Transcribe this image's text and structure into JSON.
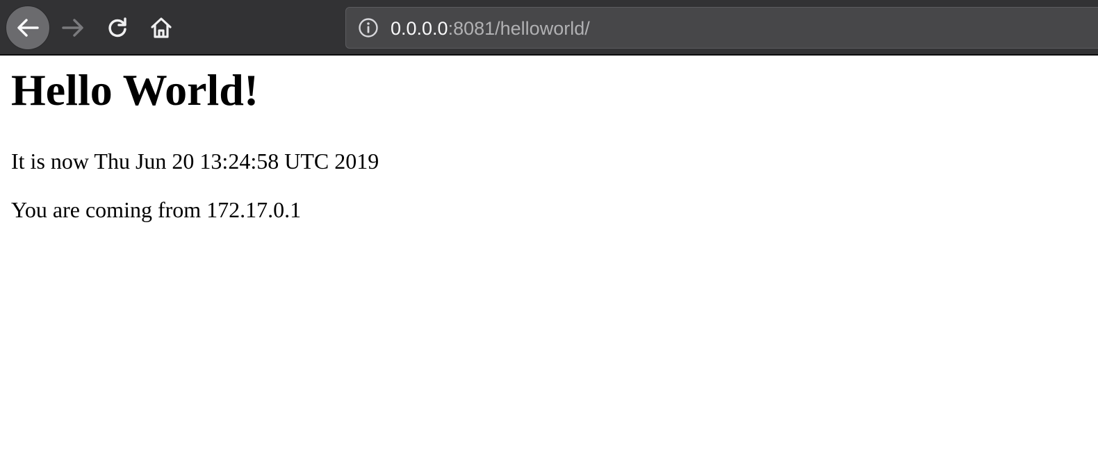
{
  "browser": {
    "url_host": "0.0.0.0",
    "url_rest": ":8081/helloworld/",
    "icons": {
      "back": "arrow-left-icon",
      "forward": "arrow-right-icon",
      "reload": "reload-icon",
      "home": "home-icon",
      "info": "info-icon"
    },
    "colors": {
      "toolbar": "#323234",
      "urlbar": "#474749",
      "url_host_text": "#f9f9fa",
      "url_rest_text": "#b1b1b3"
    }
  },
  "page": {
    "heading": "Hello World!",
    "time_line": "It is now Thu Jun 20 13:24:58 UTC 2019",
    "from_line": "You are coming from 172.17.0.1"
  }
}
